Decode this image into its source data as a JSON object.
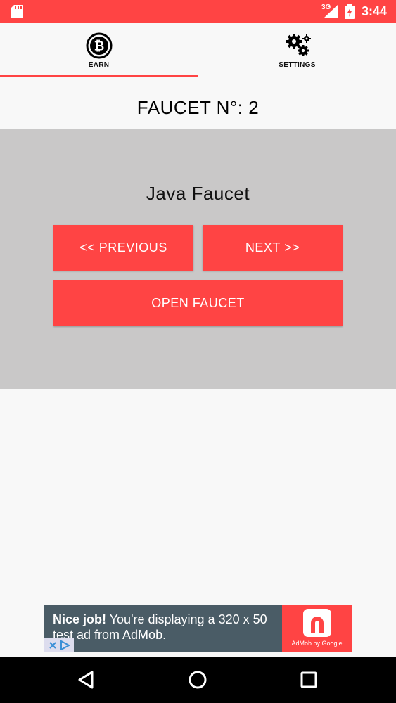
{
  "status_bar": {
    "network": "3G",
    "time": "3:44",
    "icons": [
      "sd-card-icon",
      "signal-icon",
      "battery-icon"
    ]
  },
  "tabs": [
    {
      "label": "EARN",
      "icon": "bitcoin-icon",
      "selected": true
    },
    {
      "label": "SETTINGS",
      "icon": "gears-icon",
      "selected": false
    }
  ],
  "faucet_title": "FAUCET N°: 2",
  "faucet": {
    "name": "Java Faucet",
    "previous_label": "<< PREVIOUS",
    "next_label": "NEXT >>",
    "open_label": "OPEN FAUCET"
  },
  "ad": {
    "headline": "Nice job!",
    "body": " You're displaying a 320 x 50 test ad from AdMob.",
    "brand": "AdMob by Google"
  },
  "nav": {
    "icons": [
      "back-icon",
      "home-icon",
      "recent-apps-icon"
    ]
  },
  "colors": {
    "accent": "#ff4444",
    "panel": "#c9c8c8",
    "background": "#f8f8f8",
    "ad_background": "#4a5c66"
  }
}
